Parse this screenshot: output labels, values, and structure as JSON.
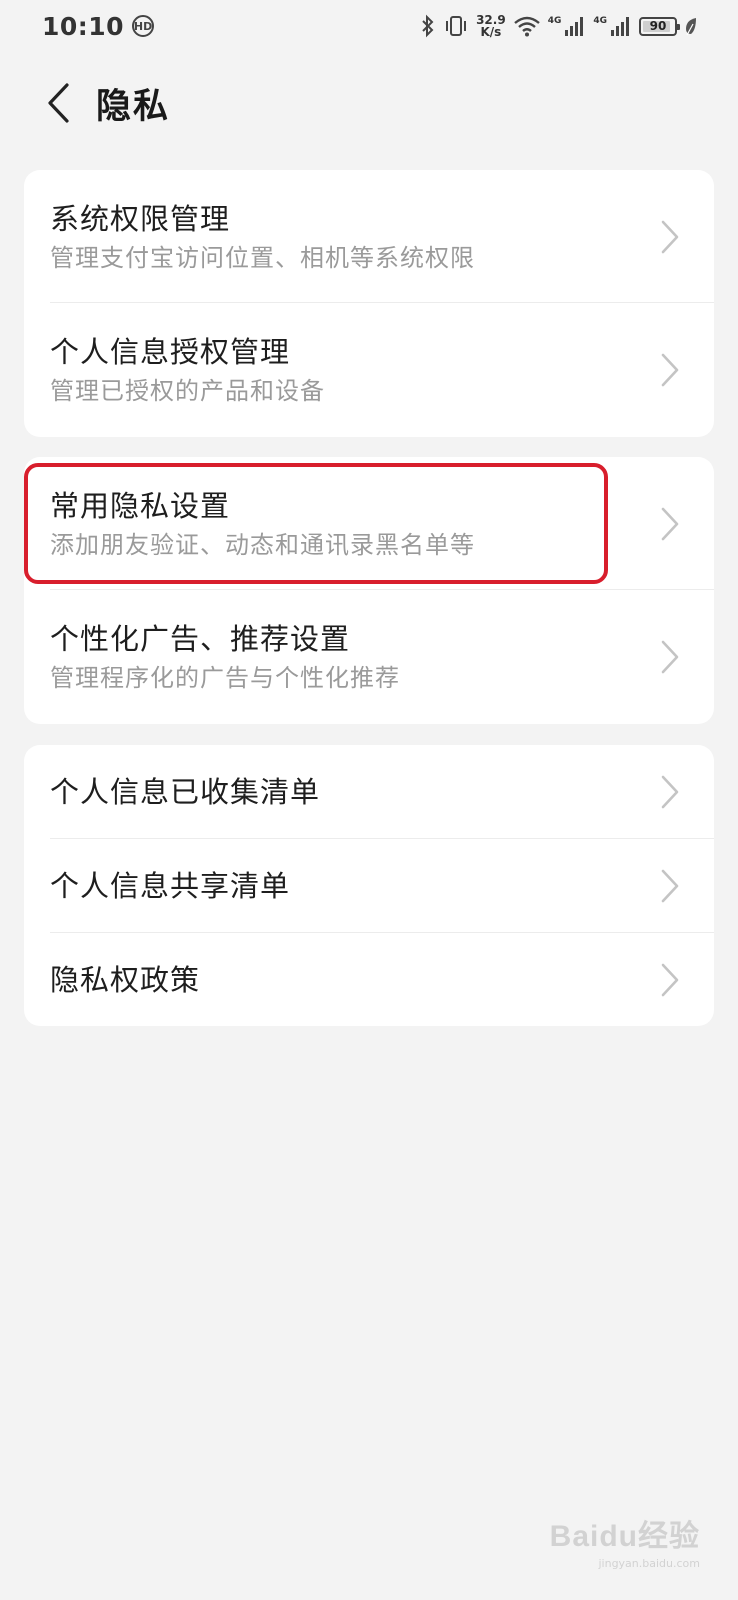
{
  "status_bar": {
    "time": "10:10",
    "sync_icon_text": "HD",
    "network_speed_value": "32.9",
    "network_speed_unit": "K/s",
    "network_tag_1": "4G",
    "network_tag_2": "4G",
    "battery_level": "90",
    "battery_fraction": 0.9
  },
  "header": {
    "title": "隐私"
  },
  "card1": {
    "items": [
      {
        "title": "系统权限管理",
        "subtitle": "管理支付宝访问位置、相机等系统权限"
      },
      {
        "title": "个人信息授权管理",
        "subtitle": "管理已授权的产品和设备"
      }
    ]
  },
  "card2": {
    "items": [
      {
        "title": "常用隐私设置",
        "subtitle": "添加朋友验证、动态和通讯录黑名单等"
      },
      {
        "title": "个性化广告、推荐设置",
        "subtitle": "管理程序化的广告与个性化推荐"
      }
    ]
  },
  "card3": {
    "items": [
      {
        "title": "个人信息已收集清单"
      },
      {
        "title": "个人信息共享清单"
      },
      {
        "title": "隐私权政策"
      }
    ]
  },
  "watermark": {
    "logo": "Baidu经验",
    "url": "jingyan.baidu.com"
  },
  "colors": {
    "background": "#f3f3f3",
    "card": "#ffffff",
    "highlight": "#d81e2c",
    "subtitle": "#9a9a9a"
  }
}
